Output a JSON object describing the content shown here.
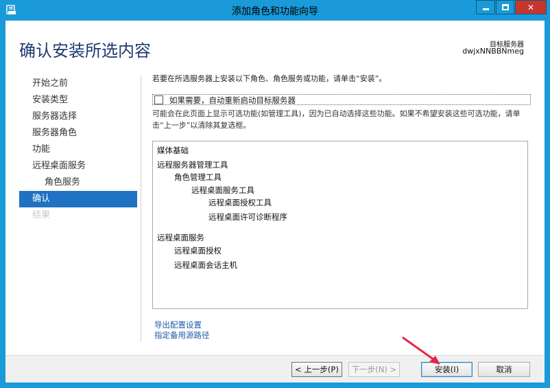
{
  "window": {
    "title": "添加角色和功能向导",
    "controls": {
      "minimize": "minimize",
      "maximize": "maximize",
      "close": "✕"
    }
  },
  "header": {
    "page_title": "确认安装所选内容",
    "target_label": "目标服务器",
    "target_name": "dwjxNNBBNmeg"
  },
  "nav": {
    "items": [
      {
        "label": "开始之前",
        "state": "normal"
      },
      {
        "label": "安装类型",
        "state": "normal"
      },
      {
        "label": "服务器选择",
        "state": "normal"
      },
      {
        "label": "服务器角色",
        "state": "normal"
      },
      {
        "label": "功能",
        "state": "normal"
      },
      {
        "label": "远程桌面服务",
        "state": "normal"
      },
      {
        "label": "角色服务",
        "state": "sub"
      },
      {
        "label": "确认",
        "state": "active"
      },
      {
        "label": "结果",
        "state": "disabled"
      }
    ]
  },
  "content": {
    "intro": "若要在所选服务器上安装以下角色、角色服务或功能，请单击“安装”。",
    "restart_checkbox": {
      "label": "如果需要，自动重新启动目标服务器",
      "checked": false
    },
    "note": "可能会在此页面上显示可选功能(如管理工具)，因为已自动选择这些功能。如果不希望安装这些可选功能，请单击“上一步”以清除其复选框。",
    "selection_list": [
      {
        "text": "媒体基础",
        "level": 0
      },
      {
        "text": "远程服务器管理工具",
        "level": 0
      },
      {
        "text": "角色管理工具",
        "level": 1
      },
      {
        "text": "远程桌面服务工具",
        "level": 2
      },
      {
        "text": "远程桌面授权工具",
        "level": 3
      },
      {
        "text": "远程桌面许可诊断程序",
        "level": 3
      },
      {
        "text": "远程桌面服务",
        "level": 0
      },
      {
        "text": "远程桌面授权",
        "level": 1
      },
      {
        "text": "远程桌面会话主机",
        "level": 1
      }
    ],
    "links": {
      "export": "导出配置设置",
      "alternate_source": "指定备用源路径"
    }
  },
  "footer": {
    "prev": "< 上一步(P)",
    "next": "下一步(N) >",
    "install": "安装(I)",
    "cancel": "取消"
  },
  "colors": {
    "titlebar": "#1a9ad8",
    "accent": "#1e72c1",
    "page_title": "#1e3a6e",
    "close_button": "#c7362d",
    "annotation_arrow": "#e8244a"
  }
}
